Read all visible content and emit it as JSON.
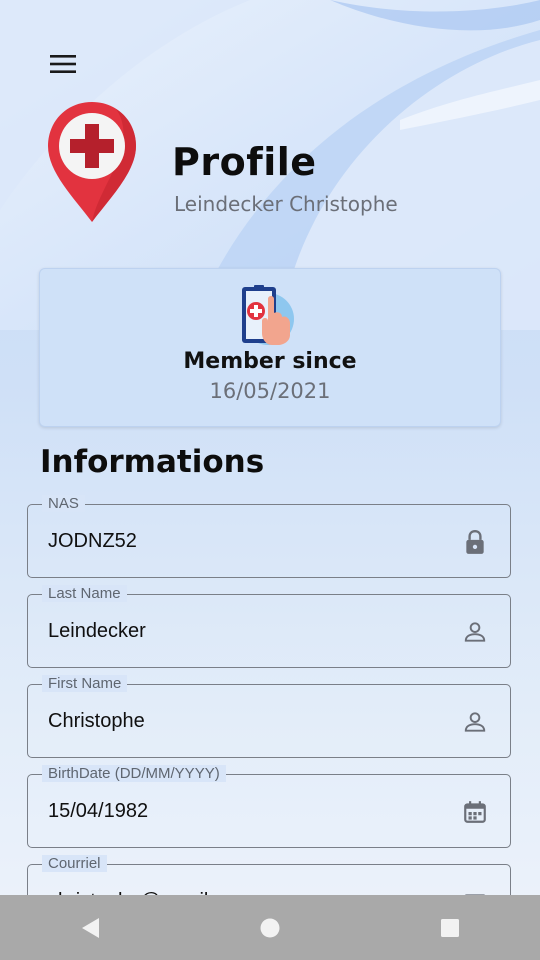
{
  "header": {
    "title": "Profile",
    "subtitle": "Leindecker Christophe"
  },
  "member": {
    "label": "Member since",
    "date": "16/05/2021"
  },
  "section_title": "Informations",
  "fields": [
    {
      "label": "NAS",
      "value": "JODNZ52",
      "icon": "lock-icon"
    },
    {
      "label": "Last Name",
      "value": "Leindecker",
      "icon": "person-icon"
    },
    {
      "label": "First Name",
      "value": "Christophe",
      "icon": "person-icon"
    },
    {
      "label": "BirthDate (DD/MM/YYYY)",
      "value": "15/04/1982",
      "icon": "calendar-icon"
    },
    {
      "label": "Courriel",
      "value": "christophe@gmail.com",
      "icon": "email-icon"
    }
  ],
  "navbar": {
    "items": [
      "back-icon",
      "home-icon",
      "recents-icon"
    ]
  },
  "colors": {
    "accent_red": "#e2333f",
    "background_blue": "#cfe0f7",
    "navbar_gray": "#a9a9a9"
  }
}
